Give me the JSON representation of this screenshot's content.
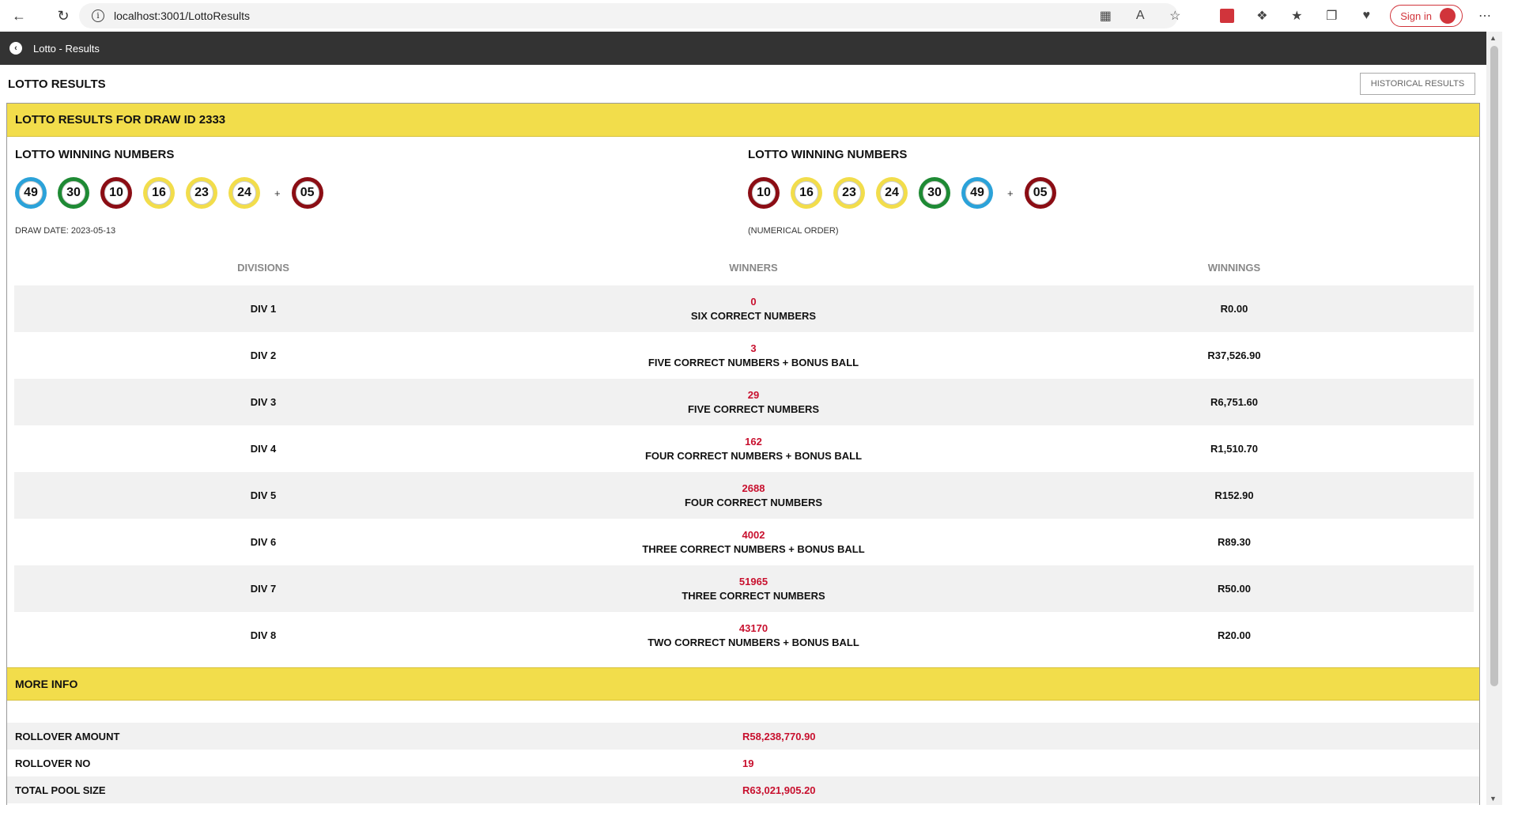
{
  "browser": {
    "url": "localhost:3001/LottoResults",
    "signin_label": "Sign in",
    "icons": [
      "back-icon",
      "refresh-icon",
      "info-icon",
      "app-icon",
      "read-aloud-icon",
      "favorite-icon",
      "office-icon",
      "extensions-icon",
      "favorites-icon",
      "collections-icon",
      "health-icon",
      "more-icon"
    ]
  },
  "header": {
    "title": "Lotto - Results"
  },
  "page": {
    "title": "LOTTO RESULTS",
    "historical_button": "HISTORICAL RESULTS",
    "panel_title": "LOTTO RESULTS FOR DRAW ID 2333"
  },
  "winning": {
    "left": {
      "heading": "LOTTO WINNING NUMBERS",
      "balls": [
        {
          "n": "49",
          "color": "blue"
        },
        {
          "n": "30",
          "color": "green"
        },
        {
          "n": "10",
          "color": "red"
        },
        {
          "n": "16",
          "color": "yellow"
        },
        {
          "n": "23",
          "color": "yellow"
        },
        {
          "n": "24",
          "color": "yellow"
        }
      ],
      "bonus": {
        "n": "05",
        "color": "red"
      },
      "note": "DRAW DATE: 2023-05-13"
    },
    "right": {
      "heading": "LOTTO WINNING NUMBERS",
      "balls": [
        {
          "n": "10",
          "color": "red"
        },
        {
          "n": "16",
          "color": "yellow"
        },
        {
          "n": "23",
          "color": "yellow"
        },
        {
          "n": "24",
          "color": "yellow"
        },
        {
          "n": "30",
          "color": "green"
        },
        {
          "n": "49",
          "color": "blue"
        }
      ],
      "bonus": {
        "n": "05",
        "color": "red"
      },
      "note": "(NUMERICAL ORDER)"
    },
    "plus": "+"
  },
  "divisions": {
    "headers": [
      "DIVISIONS",
      "WINNERS",
      "WINNINGS"
    ],
    "rows": [
      {
        "div": "DIV 1",
        "winners": "0",
        "desc": "SIX CORRECT NUMBERS",
        "winnings": "R0.00"
      },
      {
        "div": "DIV 2",
        "winners": "3",
        "desc": "FIVE CORRECT NUMBERS + BONUS BALL",
        "winnings": "R37,526.90"
      },
      {
        "div": "DIV 3",
        "winners": "29",
        "desc": "FIVE CORRECT NUMBERS",
        "winnings": "R6,751.60"
      },
      {
        "div": "DIV 4",
        "winners": "162",
        "desc": "FOUR CORRECT NUMBERS + BONUS BALL",
        "winnings": "R1,510.70"
      },
      {
        "div": "DIV 5",
        "winners": "2688",
        "desc": "FOUR CORRECT NUMBERS",
        "winnings": "R152.90"
      },
      {
        "div": "DIV 6",
        "winners": "4002",
        "desc": "THREE CORRECT NUMBERS + BONUS BALL",
        "winnings": "R89.30"
      },
      {
        "div": "DIV 7",
        "winners": "51965",
        "desc": "THREE CORRECT NUMBERS",
        "winnings": "R50.00"
      },
      {
        "div": "DIV 8",
        "winners": "43170",
        "desc": "TWO CORRECT NUMBERS + BONUS BALL",
        "winnings": "R20.00"
      }
    ]
  },
  "more_info": {
    "title": "MORE INFO",
    "rows": [
      {
        "label": "ROLLOVER AMOUNT",
        "value": "R58,238,770.90"
      },
      {
        "label": "ROLLOVER NO",
        "value": "19"
      },
      {
        "label": "TOTAL POOL SIZE",
        "value": "R63,021,905.20"
      }
    ]
  },
  "colors": {
    "accent_yellow": "#f2dd4b",
    "header_dark": "#333333",
    "value_red": "#c8102e",
    "ball_blue": "#2ba2d9",
    "ball_green": "#1e8a34",
    "ball_red": "#8b0d14"
  }
}
